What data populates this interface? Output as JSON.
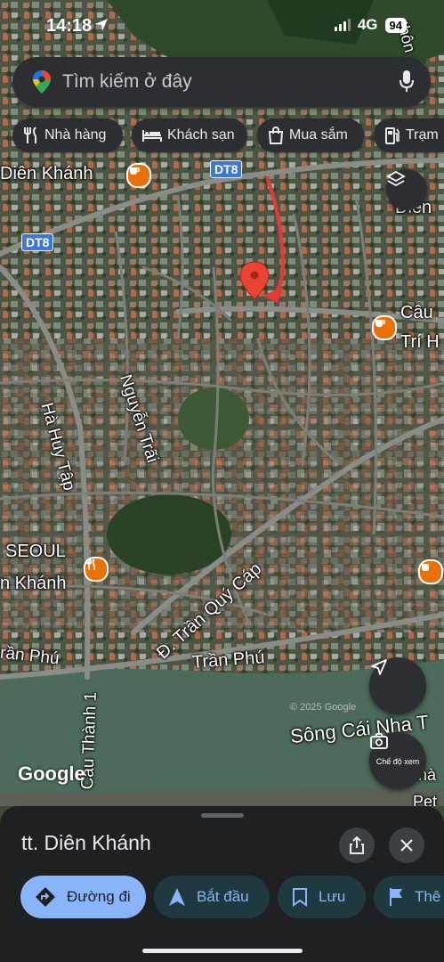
{
  "status_bar": {
    "time": "14:18",
    "network": "4G",
    "battery": "94"
  },
  "search": {
    "placeholder": "Tìm kiếm ở đây"
  },
  "chips": [
    {
      "label": "Nhà hàng",
      "icon": "restaurant-icon"
    },
    {
      "label": "Khách sạn",
      "icon": "hotel-icon"
    },
    {
      "label": "Mua sắm",
      "icon": "shopping-icon"
    },
    {
      "label": "Trạm",
      "icon": "gas-station-icon"
    }
  ],
  "map": {
    "labels": {
      "dien_khanh": "Diên Khánh",
      "dt8_a": "DT8",
      "dt8_b": "DT8",
      "diem": "Diên",
      "cau_tri": "Câu",
      "cau_tri2": "Trí H",
      "ha_huy_tap": "Hà Huy Tập",
      "nguyen_trai": "Nguyễn Trãi",
      "seoul": "SEOUL",
      "n_khanh": "n Khánh",
      "tran_quy_cap": "Đ. Trần Quý Cáp",
      "tran_phu_left": "rần Phú",
      "tran_phu": "Trần Phú",
      "cau_thanh": "Cầu Thành 1",
      "song_cai": "Sông Cái Nha T",
      "na": "nà",
      "pet": "Pet",
      "thon": "thôn"
    },
    "google_logo": "Google",
    "watermark": "© 2025 Google",
    "view_mode": "Chế độ xem"
  },
  "place": {
    "name": "tt. Diên Khánh"
  },
  "actions": [
    {
      "label": "Đường đi",
      "icon": "directions-icon"
    },
    {
      "label": "Bắt đầu",
      "icon": "navigation-icon"
    },
    {
      "label": "Lưu",
      "icon": "bookmark-icon"
    },
    {
      "label": "Thê",
      "icon": "flag-icon"
    }
  ],
  "colors": {
    "pin": "#ea4335",
    "accent": "#8ab4f8",
    "route_arrow": "#e53935",
    "road": "#8a8d87",
    "river": "#4c6b5a"
  }
}
